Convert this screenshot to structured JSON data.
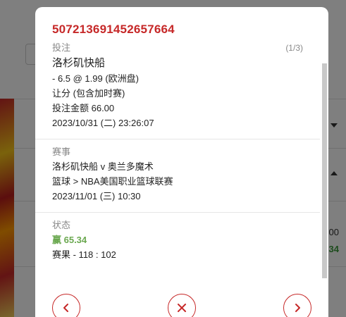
{
  "background": {
    "right_values": [
      "00",
      "34"
    ]
  },
  "modal": {
    "bet_id": "507213691452657664",
    "partial_top_label": "投注",
    "partial_top_right": "(1/3)",
    "bet": {
      "selection": "洛杉矶快船",
      "handicap": "- 6.5 @ 1.99 (欧洲盘)",
      "market": "让分 (包含加时赛)",
      "stake": "投注金额 66.00",
      "placed_time": "2023/10/31 (二) 23:26:07"
    },
    "event": {
      "label": "赛事",
      "teams": "洛杉矶快船 v 奥兰多魔术",
      "league": "篮球 > NBA美国职业篮球联赛",
      "start_time": "2023/11/01 (三) 10:30"
    },
    "status": {
      "label": "状态",
      "result": "赢 65.34",
      "score": "赛果 - 118 : 102"
    },
    "colors": {
      "accent": "#c62828",
      "win": "#6aa84f"
    },
    "footer": {
      "prev_icon": "chevron-left-icon",
      "close_icon": "close-icon",
      "next_icon": "chevron-right-icon"
    }
  }
}
